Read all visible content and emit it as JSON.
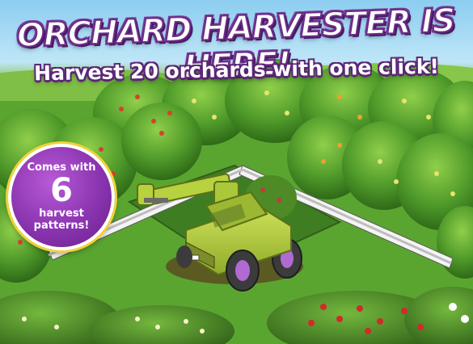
{
  "banner": {
    "headline": "ORCHARD HARVESTER IS HERE!",
    "subline": "Harvest 20 orchards with one click!"
  },
  "badge": {
    "line1": "Comes with",
    "number": "6",
    "line3": "harvest",
    "line4": "patterns!"
  },
  "colors": {
    "title_outline": "#6a2d86",
    "badge_purple": "#8a34b0",
    "badge_ring": "#f2d23a",
    "harvester_green": "#a9c83a",
    "wheel_purple": "#b06ad2",
    "grass": "#4f9a2a",
    "dirt": "#5b3a1e"
  },
  "icons": [
    "orchard-tree",
    "fence",
    "orchard-harvester-vehicle",
    "flower-bush"
  ]
}
